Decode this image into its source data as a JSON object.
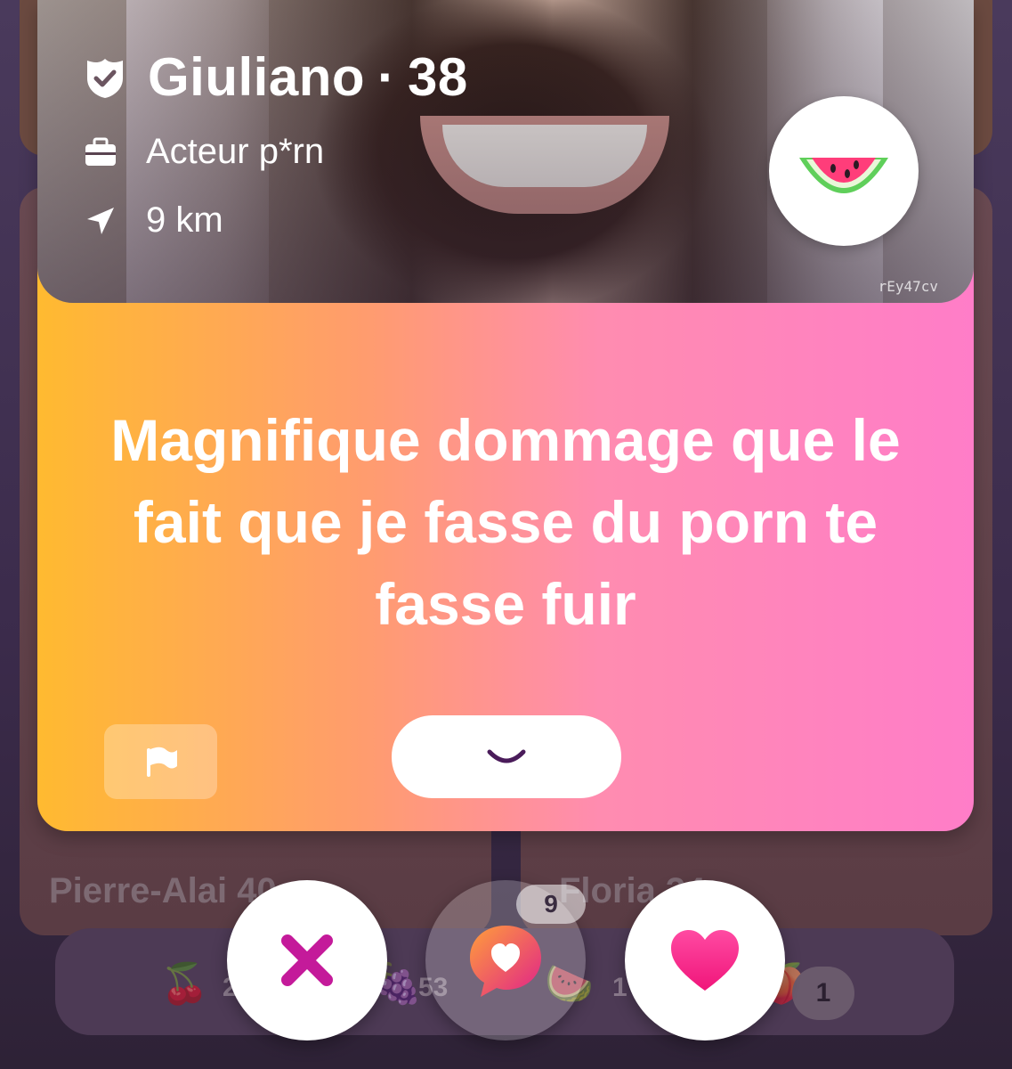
{
  "profile": {
    "name": "Giuliano",
    "separator": "·",
    "age": "38",
    "job": "Acteur p*rn",
    "distance": "9 km",
    "photo_id": "rEy47cv",
    "badge_icon": "watermelon-icon",
    "verified_icon": "verified-shield-icon"
  },
  "prompt": {
    "answer": "Magnifique dommage que le fait que je fasse du porn te fasse fuir"
  },
  "card_actions": {
    "report_icon": "flag-icon",
    "expand_icon": "chevron-down-icon"
  },
  "background_list": {
    "left_name": "Pierre-Alai  40",
    "right_name": "Floria   34",
    "stats": [
      {
        "icon": "cherry-icon",
        "value": "2"
      },
      {
        "icon": "grape-icon",
        "value": "53"
      },
      {
        "icon": "watermelon-icon",
        "value": "1"
      },
      {
        "icon": "peach-icon",
        "value": "1"
      }
    ]
  },
  "actions": {
    "pass_icon": "close-icon",
    "message_icon": "heart-message-icon",
    "message_count": "9",
    "like_icon": "heart-icon"
  },
  "colors": {
    "card_gradient_start": "#ffba30",
    "card_gradient_end": "#ff7dc8",
    "pass_accent": "#c41a9a",
    "like_accent": "#ff2d8c",
    "chevron": "#4a1c5a"
  }
}
